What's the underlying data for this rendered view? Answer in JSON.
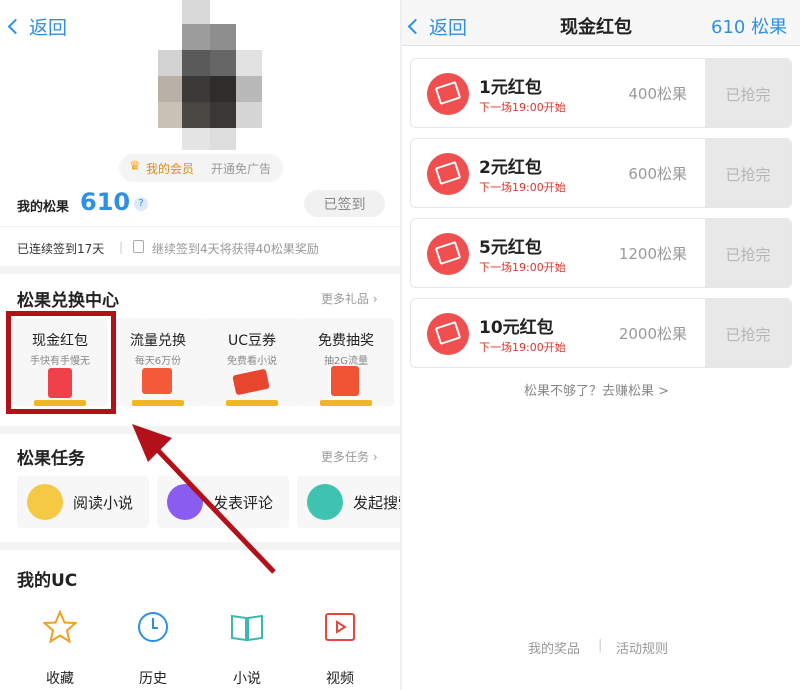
{
  "left": {
    "back_label": "返回",
    "member_label": "我的会员",
    "ad_free_label": "开通免广告",
    "points_label": "我的松果",
    "points_value": "610",
    "help_symbol": "?",
    "signed_button": "已签到",
    "streak_text": "已连续签到17天",
    "reward_hint": "继续签到4天将获得40松果奖励",
    "exchange": {
      "title": "松果兑换中心",
      "more": "更多礼品",
      "cards": [
        {
          "title": "现金红包",
          "sub": "手快有手慢无"
        },
        {
          "title": "流量兑换",
          "sub": "每天6万份"
        },
        {
          "title": "UC豆券",
          "sub": "免费看小说"
        },
        {
          "title": "免费抽奖",
          "sub": "抽2G流量"
        }
      ]
    },
    "tasks": {
      "title": "松果任务",
      "more": "更多任务",
      "items": [
        {
          "label": "阅读小说"
        },
        {
          "label": "发表评论"
        },
        {
          "label": "发起搜索"
        }
      ]
    },
    "my_uc": {
      "title": "我的UC",
      "items": [
        {
          "label": "收藏",
          "icon": "star-icon"
        },
        {
          "label": "历史",
          "icon": "clock-icon"
        },
        {
          "label": "小说",
          "icon": "book-icon"
        },
        {
          "label": "视频",
          "icon": "video-icon"
        }
      ]
    }
  },
  "right": {
    "back_label": "返回",
    "title": "现金红包",
    "balance": "610 松果",
    "items": [
      {
        "name": "1元红包",
        "sub": "下一场19:00开始",
        "price": "400松果",
        "button": "已抢完"
      },
      {
        "name": "2元红包",
        "sub": "下一场19:00开始",
        "price": "600松果",
        "button": "已抢完"
      },
      {
        "name": "5元红包",
        "sub": "下一场19:00开始",
        "price": "1200松果",
        "button": "已抢完"
      },
      {
        "name": "10元红包",
        "sub": "下一场19:00开始",
        "price": "2000松果",
        "button": "已抢完"
      }
    ],
    "earn_link": "松果不够了？去赚松果 >",
    "footer_prizes": "我的奖品",
    "footer_rules": "活动规则"
  },
  "colors": {
    "accent": "#2e8fe6",
    "red": "#e0342b",
    "highlight_box": "#b2111a"
  }
}
